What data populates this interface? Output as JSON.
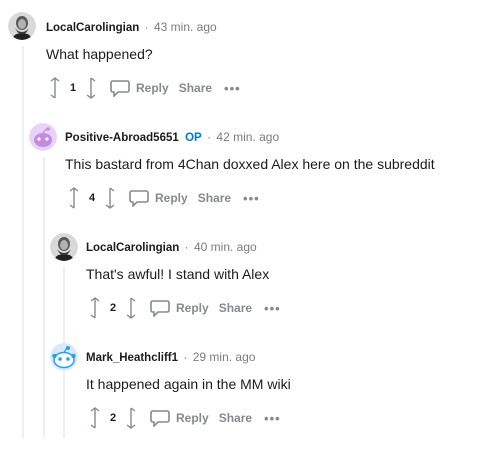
{
  "comments": [
    {
      "username": "LocalCarolingian",
      "op": "",
      "timestamp": "43 min. ago",
      "body": "What happened?",
      "votes": "1",
      "reply_label": "Reply",
      "share_label": "Share",
      "more_label": "•••",
      "avatar": "bearded-man-avatar"
    },
    {
      "username": "Positive-Abroad5651",
      "op": "OP",
      "timestamp": "42 min. ago",
      "body": "This bastard from 4Chan doxxed Alex here on the subreddit",
      "votes": "4",
      "reply_label": "Reply",
      "share_label": "Share",
      "more_label": "•••",
      "avatar": "purple-snoo-avatar"
    },
    {
      "username": "LocalCarolingian",
      "op": "",
      "timestamp": "40 min. ago",
      "body": "That's awful! I stand with Alex",
      "votes": "2",
      "reply_label": "Reply",
      "share_label": "Share",
      "more_label": "•••",
      "avatar": "bearded-man-avatar"
    },
    {
      "username": "Mark_Heathcliff1",
      "op": "",
      "timestamp": "29 min. ago",
      "body": "It happened again in the MM wiki",
      "votes": "2",
      "reply_label": "Reply",
      "share_label": "Share",
      "more_label": "•••",
      "avatar": "blue-snoo-avatar"
    }
  ],
  "separator": "·",
  "colors": {
    "text": "#1c1c1c",
    "muted": "#7c7c7c",
    "action": "#878a8c",
    "op_blue": "#0079d3",
    "thread_line": "#edeff1"
  }
}
